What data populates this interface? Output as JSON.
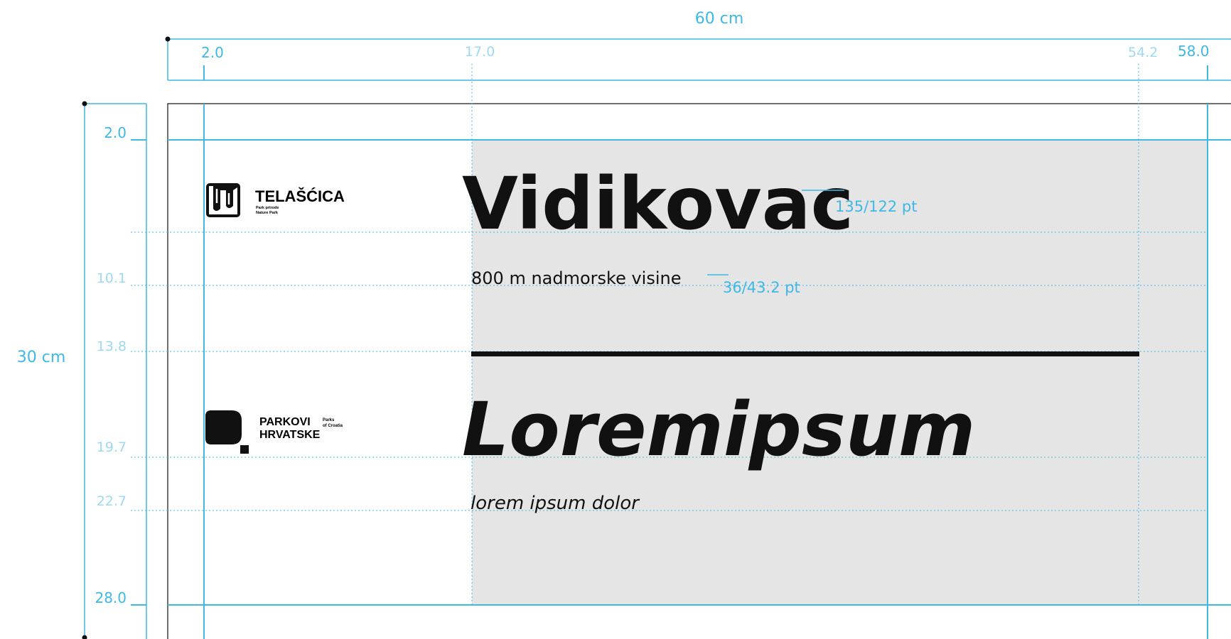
{
  "dimensions": {
    "width_label": "60 cm",
    "height_label": "30 cm",
    "top_ticks": [
      "2.0",
      "17.0",
      "54.2",
      "58.0"
    ],
    "left_ticks": [
      "2.0",
      "10.1",
      "13.8",
      "19.7",
      "22.7",
      "28.0"
    ]
  },
  "colors": {
    "guide": "#3fb8e5",
    "guide_faint": "#9fd9ef",
    "panel": "#e5e5e5",
    "text": "#111111"
  },
  "headline_1": {
    "title": "Vidikovac",
    "title_spec": "135/122 pt",
    "subtitle": "800 m nadmorske visine",
    "subtitle_spec": "36/43.2 pt"
  },
  "headline_2": {
    "title": "Loremipsum",
    "subtitle": "lorem ipsum dolor"
  },
  "logo_telascica": {
    "name": "TELAŠĆICA",
    "line1": "Park prirode",
    "line2": "Nature Park",
    "icon": "telascica-cliff-icon"
  },
  "logo_parkovi": {
    "name_line1": "PARKOVI",
    "name_line2": "HRVATSKE",
    "tag_line1": "Parks",
    "tag_line2": "of Croatia",
    "icon": "parkovi-leaf-icon"
  }
}
